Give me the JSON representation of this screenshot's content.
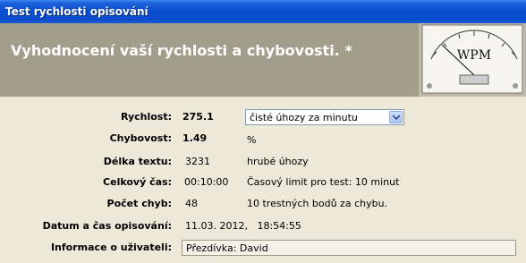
{
  "window": {
    "title": "Test rychlosti opisování"
  },
  "header": {
    "title": "Vyhodnocení vaší rychlosti a chybovosti. *",
    "meter_label": "WPM"
  },
  "results": {
    "speed": {
      "label": "Rychlost:",
      "value": "275.1",
      "unit_selected": "čisté úhozy za minutu"
    },
    "errors": {
      "label": "Chybovost:",
      "value": "1.49",
      "unit": "%"
    },
    "length": {
      "label": "Délka textu:",
      "value": "3231",
      "unit": "hrubé úhozy"
    },
    "time": {
      "label": "Celkový čas:",
      "value": "00:10:00",
      "note": "Časový limit pro test: 10 minut"
    },
    "mistakes": {
      "label": "Počet chyb:",
      "value": "48",
      "note": "10 trestných bodů za chybu."
    },
    "datetime": {
      "label": "Datum a čas opisování:",
      "value": "11.03. 2012,   18:54:55"
    },
    "user": {
      "label": "Informace o uživateli:",
      "value": "Přezdívka: David"
    }
  }
}
